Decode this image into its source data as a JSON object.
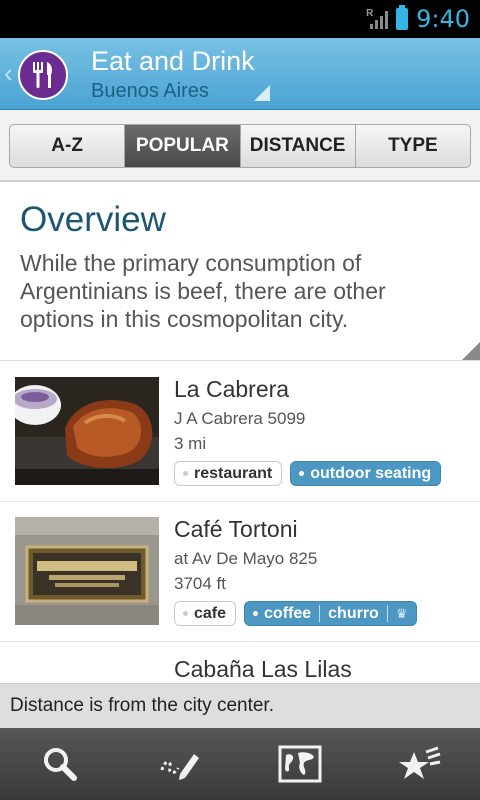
{
  "status_bar": {
    "time": "9:40",
    "network_badge": "R",
    "signal_icon": "signal-icon",
    "battery_icon": "battery-icon"
  },
  "action_bar": {
    "title": "Eat and Drink",
    "subtitle": "Buenos Aires",
    "back_icon": "chevron-left-icon",
    "logo_icon": "fork-knife-icon",
    "logo_color": "#6a2c91",
    "accent_color": "#4aa3d3"
  },
  "tabs": [
    {
      "label": "A-Z",
      "active": false
    },
    {
      "label": "POPULAR",
      "active": true
    },
    {
      "label": "DISTANCE",
      "active": false
    },
    {
      "label": "TYPE",
      "active": false
    }
  ],
  "overview": {
    "title": "Overview",
    "text": "While the primary consumption of Argentinians is beef, there are other options in this cosmopolitan city."
  },
  "places": [
    {
      "name": "La Cabrera",
      "address": "J A Cabrera 5099",
      "distance": "3 mi",
      "tags": {
        "plain": "restaurant",
        "blue": [
          "outdoor seating"
        ]
      }
    },
    {
      "name": "Café Tortoni",
      "address": "at Av De Mayo 825",
      "distance": "3704 ft",
      "tags": {
        "plain": "cafe",
        "blue": [
          "coffee",
          "churro"
        ]
      }
    },
    {
      "name": "Cabaña Las Lilas"
    }
  ],
  "info_bar": {
    "text": "Distance is from the city center."
  },
  "bottom_nav": [
    "search-icon",
    "edit-icon",
    "map-icon",
    "favorites-icon"
  ]
}
